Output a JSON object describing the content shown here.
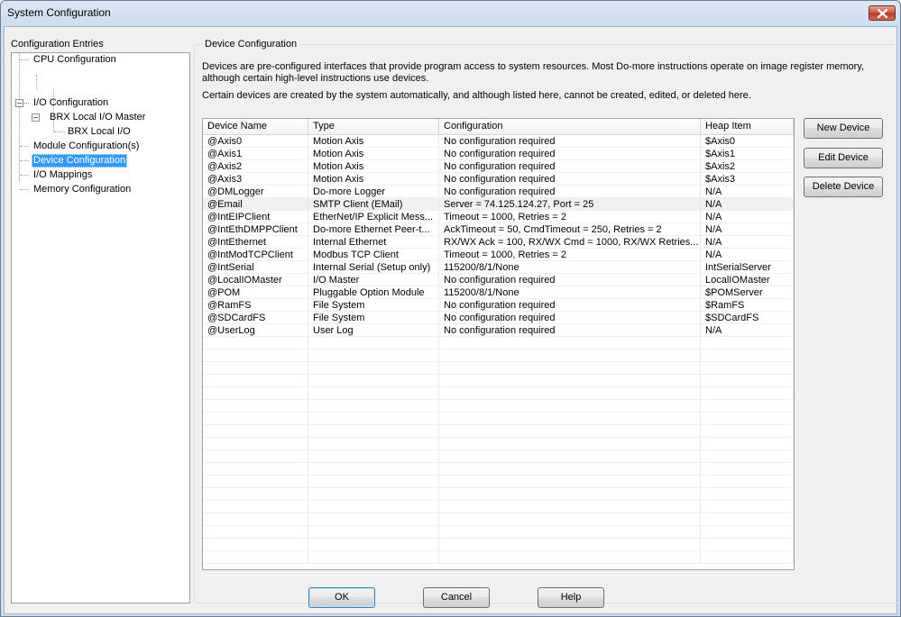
{
  "window": {
    "title": "System Configuration"
  },
  "tree": {
    "label": "Configuration Entries",
    "items": [
      {
        "label": "CPU Configuration"
      },
      {
        "label": "I/O Configuration"
      },
      {
        "label": "BRX Local I/O Master"
      },
      {
        "label": "BRX Local I/O"
      },
      {
        "label": "Module Configuration(s)"
      },
      {
        "label": "Device Configuration"
      },
      {
        "label": "I/O Mappings"
      },
      {
        "label": "Memory Configuration"
      }
    ]
  },
  "panel": {
    "group_label": "Device Configuration",
    "description1": "Devices are pre-configured interfaces that provide program access to system resources. Most Do-more instructions operate on image register memory, although certain high-level instructions use devices.",
    "description2": "Certain devices are created by the system automatically, and although listed here, cannot be created, edited, or deleted here."
  },
  "table": {
    "columns": [
      "Device Name",
      "Type",
      "Configuration",
      "Heap Item"
    ],
    "rows": [
      [
        "@Axis0",
        "Motion Axis",
        "No configuration required",
        "$Axis0"
      ],
      [
        "@Axis1",
        "Motion Axis",
        "No configuration required",
        "$Axis1"
      ],
      [
        "@Axis2",
        "Motion Axis",
        "No configuration required",
        "$Axis2"
      ],
      [
        "@Axis3",
        "Motion Axis",
        "No configuration required",
        "$Axis3"
      ],
      [
        "@DMLogger",
        "Do-more Logger",
        "No configuration required",
        "N/A"
      ],
      [
        "@Email",
        "SMTP Client (EMail)",
        "Server = 74.125.124.27, Port = 25",
        "N/A"
      ],
      [
        "@IntEIPClient",
        "EtherNet/IP Explicit Mess...",
        "Timeout = 1000, Retries = 2",
        "N/A"
      ],
      [
        "@IntEthDMPPClient",
        "Do-more Ethernet Peer-t...",
        "AckTimeout = 50, CmdTimeout = 250, Retries = 2",
        "N/A"
      ],
      [
        "@IntEthernet",
        "Internal Ethernet",
        "RX/WX Ack = 100, RX/WX Cmd = 1000, RX/WX Retries...",
        "N/A"
      ],
      [
        "@IntModTCPClient",
        "Modbus TCP Client",
        "Timeout = 1000, Retries = 2",
        "N/A"
      ],
      [
        "@IntSerial",
        "Internal Serial (Setup only)",
        "115200/8/1/None",
        "IntSerialServer"
      ],
      [
        "@LocalIOMaster",
        "I/O Master",
        "No configuration required",
        "LocalIOMaster"
      ],
      [
        "@POM",
        "Pluggable Option Module",
        "115200/8/1/None",
        "$POMServer"
      ],
      [
        "@RamFS",
        "File System",
        "No configuration required",
        "$RamFS"
      ],
      [
        "@SDCardFS",
        "File System",
        "No configuration required",
        "$SDCardFS"
      ],
      [
        "@UserLog",
        "User Log",
        "No configuration required",
        "N/A"
      ]
    ]
  },
  "buttons": {
    "new_device": "New Device",
    "edit_device": "Edit Device",
    "delete_device": "Delete Device",
    "ok": "OK",
    "cancel": "Cancel",
    "help": "Help"
  }
}
